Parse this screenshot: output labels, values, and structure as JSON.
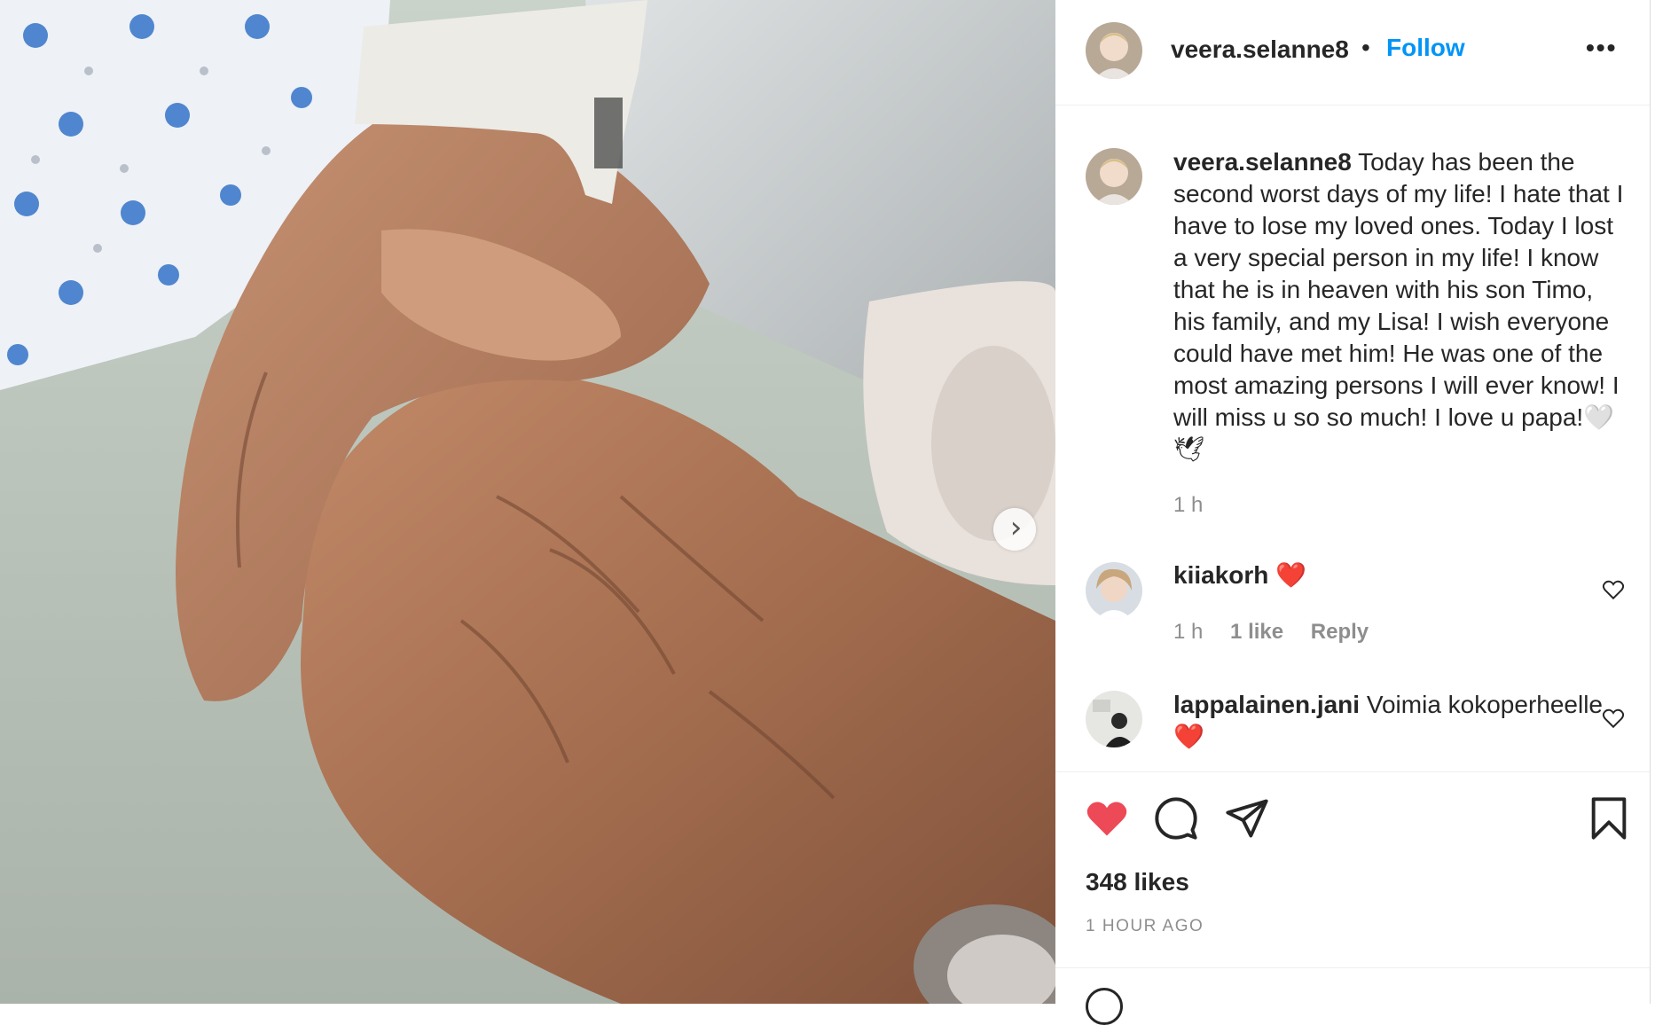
{
  "colors": {
    "follow": "#0095f6",
    "liked_heart": "#ed4956",
    "muted_text": "#8e8e8e",
    "text": "#262626"
  },
  "header": {
    "username": "veera.selanne8",
    "separator": "•",
    "follow_label": "Follow",
    "more_label": "•••"
  },
  "caption": {
    "username": "veera.selanne8",
    "text": "Today has been the second worst days of my life! I hate that I have to lose my loved ones. Today I lost a very special person in my life! I know that he is in heaven with his son Timo, his family, and my Lisa! I wish everyone could have met him! He was one of the most amazing persons I will ever know! I will miss u so so much! I love u papa!🤍🕊",
    "time": "1 h"
  },
  "comments": [
    {
      "username": "kiiakorh",
      "text": "❤️",
      "time": "1 h",
      "likes": "1 like",
      "reply": "Reply"
    },
    {
      "username": "lappalainen.jani",
      "text": "Voimia kokoperheelle❤️"
    }
  ],
  "actions": {
    "like_icon": "heart-filled-icon",
    "comment_icon": "comment-bubble-icon",
    "share_icon": "paper-plane-icon",
    "save_icon": "bookmark-icon"
  },
  "likes": "348 likes",
  "time_ago": "1 HOUR AGO",
  "carousel": {
    "next_icon": "chevron-right-icon",
    "next_glyph": "›"
  }
}
